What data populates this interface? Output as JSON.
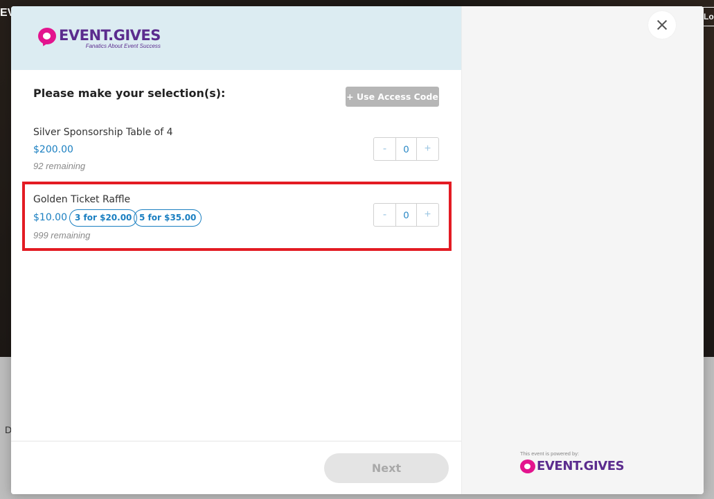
{
  "background": {
    "brand_fragment": "EV",
    "login_fragment": "Lo",
    "lower_fragment": "D"
  },
  "header": {
    "logo_name": "EVENT.GIVES",
    "logo_tagline": "Fanatics About Event Success",
    "background_color": "#dcecf2"
  },
  "selection": {
    "title": "Please make your selection(s):",
    "access_code_label": "+ Use Access Code"
  },
  "items": [
    {
      "name": "Silver Sponsorship Table of 4",
      "price": "$200.00",
      "remaining": "92 remaining",
      "quantity": "0",
      "minus": "-",
      "plus": "+"
    },
    {
      "name": "Golden Ticket Raffle",
      "price": "$10.00",
      "bundles": [
        "3 for $20.00",
        "5 for $35.00"
      ],
      "remaining": "999 remaining",
      "quantity": "0",
      "minus": "-",
      "plus": "+",
      "highlighted": true
    }
  ],
  "footer": {
    "next_label": "Next"
  },
  "powered_by": {
    "text": "This event is powered by:",
    "logo_name": "EVENT.GIVES"
  },
  "colors": {
    "accent_blue": "#1a7fc1",
    "brand_purple": "#5b2c8e",
    "brand_pink": "#e3148e",
    "highlight_red": "#e31b23"
  },
  "icons": {
    "close": "close-icon",
    "logo": "heart-logo-icon"
  }
}
